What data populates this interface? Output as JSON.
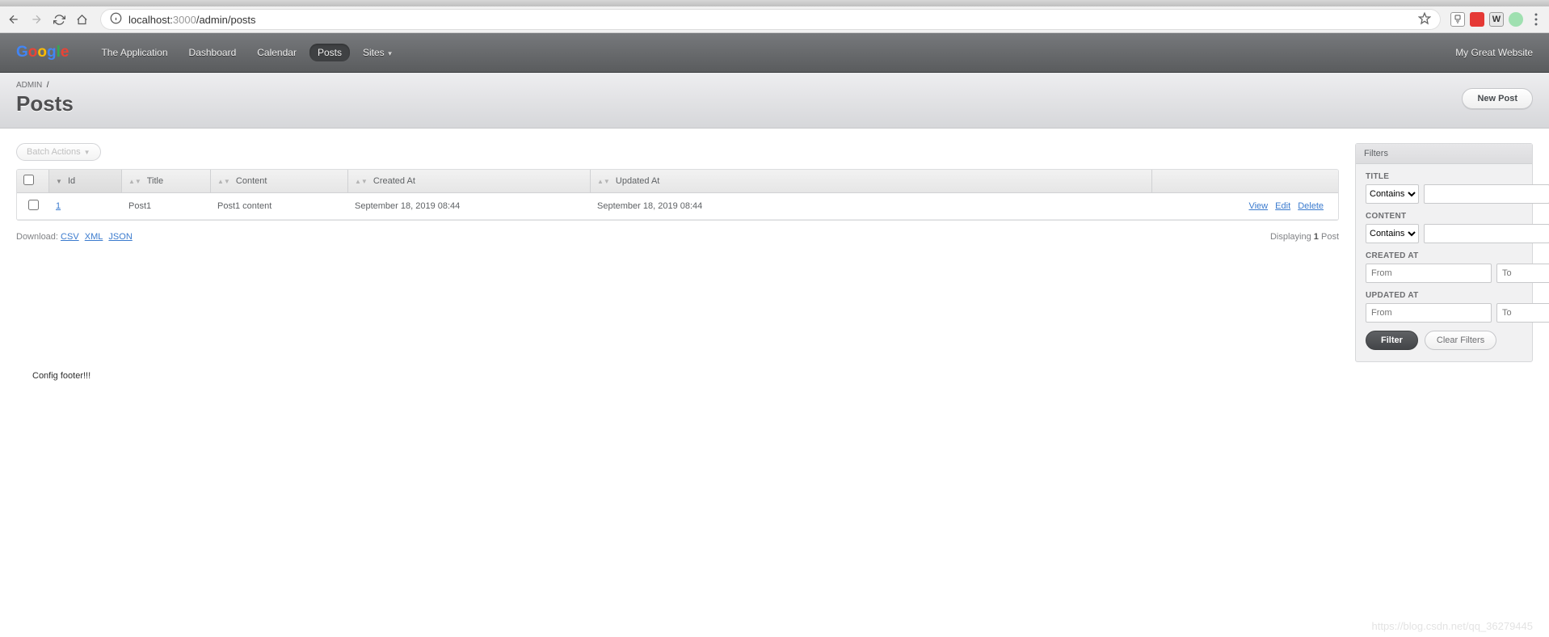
{
  "browser": {
    "url_scheme": "localhost:",
    "url_port": "3000",
    "url_path": "/admin/posts",
    "ext_w": "W"
  },
  "nav": {
    "logo": {
      "g": "G",
      "o1": "o",
      "o2": "o",
      "g2": "g",
      "l": "l",
      "e": "e"
    },
    "links": [
      {
        "label": "The Application",
        "active": false
      },
      {
        "label": "Dashboard",
        "active": false
      },
      {
        "label": "Calendar",
        "active": false
      },
      {
        "label": "Posts",
        "active": true
      },
      {
        "label": "Sites",
        "active": false,
        "dropdown": true
      }
    ],
    "site_title": "My Great Website"
  },
  "titlebar": {
    "breadcrumb_root": "ADMIN",
    "breadcrumb_sep": "/",
    "page_title": "Posts",
    "new_btn": "New Post"
  },
  "batch_actions_label": "Batch Actions",
  "table": {
    "headers": {
      "id": "Id",
      "title": "Title",
      "content": "Content",
      "created_at": "Created At",
      "updated_at": "Updated At"
    },
    "rows": [
      {
        "id": "1",
        "title": "Post1",
        "content": "Post1 content",
        "created_at": "September 18, 2019 08:44",
        "updated_at": "September 18, 2019 08:44",
        "actions": {
          "view": "View",
          "edit": "Edit",
          "delete": "Delete"
        }
      }
    ]
  },
  "download": {
    "label": "Download:",
    "csv": "CSV",
    "xml": "XML",
    "json": "JSON"
  },
  "pagination": {
    "pre": "Displaying",
    "count": "1",
    "post": "Post"
  },
  "filters": {
    "heading": "Filters",
    "groups": {
      "title": {
        "label": "TITLE",
        "op": "Contains"
      },
      "content": {
        "label": "CONTENT",
        "op": "Contains"
      },
      "created_at": {
        "label": "CREATED AT",
        "from": "From",
        "to": "To"
      },
      "updated_at": {
        "label": "UPDATED AT",
        "from": "From",
        "to": "To"
      }
    },
    "filter_btn": "Filter",
    "clear_btn": "Clear Filters"
  },
  "config_footer": "Config footer!!!",
  "watermark": "https://blog.csdn.net/qq_36279445"
}
